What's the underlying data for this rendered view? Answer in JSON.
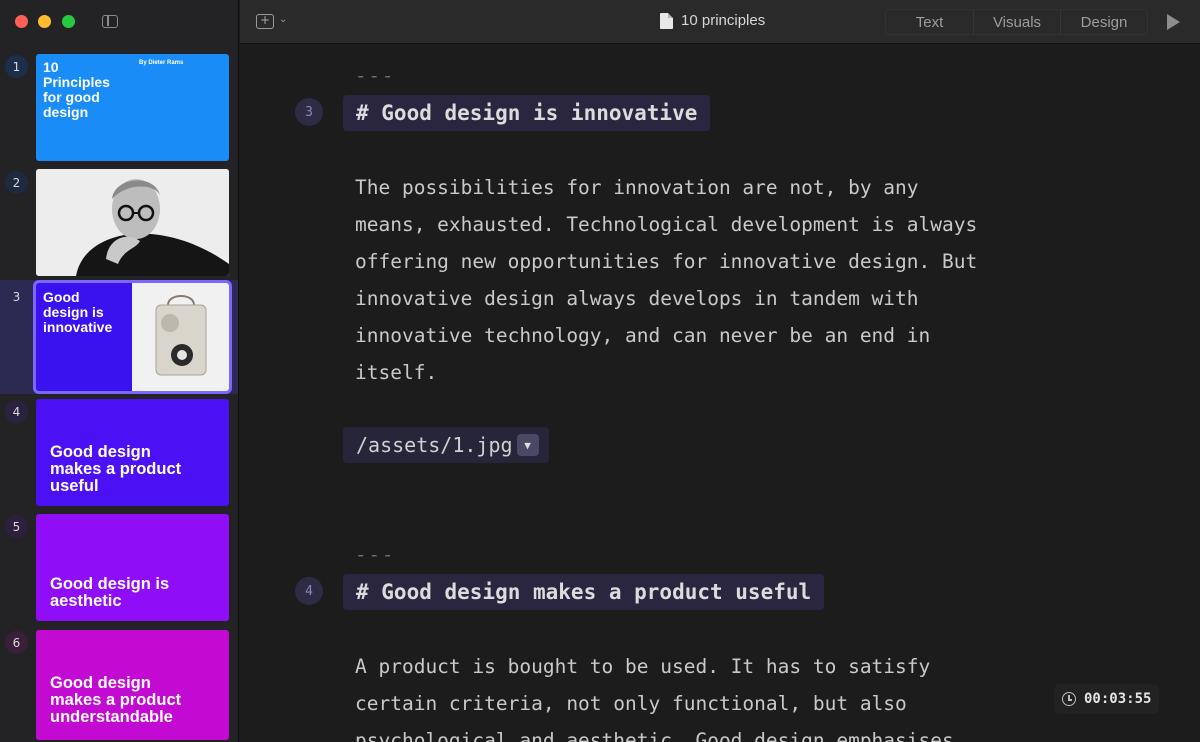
{
  "window": {
    "title": "10 principles"
  },
  "toolbar": {
    "view_tabs": [
      "Text",
      "Visuals",
      "Design"
    ]
  },
  "sidebar": {
    "slides": [
      {
        "number": "1",
        "title": "10\nPrinciples\nfor good\ndesign",
        "subtitle": "By Dieter Rams",
        "bg": "#1a8cf7"
      },
      {
        "number": "2",
        "title": "",
        "bg": "#ececec",
        "image": "portrait"
      },
      {
        "number": "3",
        "title": "Good\ndesign is\ninnovative",
        "bg": "#3a12f0",
        "image": "radio",
        "selected": true
      },
      {
        "number": "4",
        "title": "Good design\nmakes a product\nuseful",
        "bg": "#4c10f5"
      },
      {
        "number": "5",
        "title": "Good design is\naesthetic",
        "bg": "#8f0df7"
      },
      {
        "number": "6",
        "title": "Good design\nmakes a product\nunderstandable",
        "bg": "#c30ad3"
      }
    ]
  },
  "editor": {
    "separator": "---",
    "sections": [
      {
        "badge": "3",
        "heading": "# Good design is innovative",
        "lines": [
          "The possibilities for innovation are not, by any",
          "means, exhausted. Technological development is always",
          "offering new opportunities for innovative design. But",
          "innovative design always develops in tandem with",
          "innovative technology, and can never be an end in",
          "itself."
        ],
        "asset": "/assets/1.jpg"
      },
      {
        "badge": "4",
        "heading": "# Good design makes a product useful",
        "lines": [
          "A product is bought to be used. It has to satisfy",
          "certain criteria, not only functional, but also",
          "psychological and aesthetic. Good design emphasises"
        ]
      }
    ]
  },
  "timer": {
    "value": "00:03:55"
  },
  "colors": {
    "accent": "#7b66ff",
    "heading_bg": "#2b2640"
  }
}
